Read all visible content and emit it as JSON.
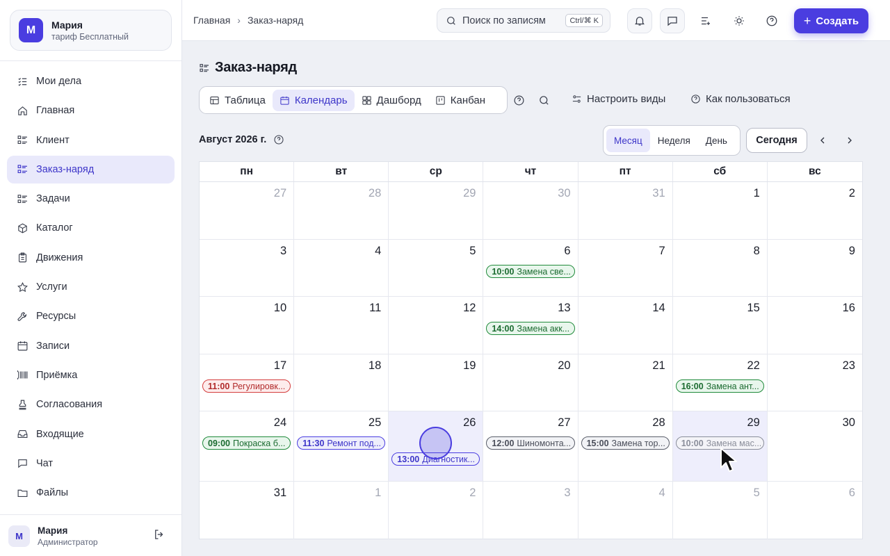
{
  "workspace": {
    "avatar": "М",
    "name": "Мария",
    "plan": "тариф Бесплатный"
  },
  "sidebar": {
    "items": [
      {
        "label": "Мои дела",
        "icon": "checklist-icon"
      },
      {
        "label": "Главная",
        "icon": "home-icon"
      },
      {
        "label": "Клиент",
        "icon": "list-icon"
      },
      {
        "label": "Заказ-наряд",
        "icon": "list-icon",
        "active": true
      },
      {
        "label": "Задачи",
        "icon": "list-icon"
      },
      {
        "label": "Каталог",
        "icon": "box-icon"
      },
      {
        "label": "Движения",
        "icon": "clipboard-icon"
      },
      {
        "label": "Услуги",
        "icon": "star-icon"
      },
      {
        "label": "Ресурсы",
        "icon": "wrench-icon"
      },
      {
        "label": "Записи",
        "icon": "calendar-icon"
      },
      {
        "label": "Приёмка",
        "icon": "barcode-icon"
      },
      {
        "label": "Согласования",
        "icon": "stamp-icon"
      },
      {
        "label": "Входящие",
        "icon": "inbox-icon"
      },
      {
        "label": "Чат",
        "icon": "chat-icon"
      },
      {
        "label": "Файлы",
        "icon": "folder-icon"
      }
    ]
  },
  "user": {
    "avatar": "М",
    "name": "Мария",
    "role": "Администратор"
  },
  "topbar": {
    "breadcrumb": [
      "Главная",
      "Заказ-наряд"
    ],
    "search_placeholder": "Поиск по записям",
    "search_shortcut": "Ctrl/⌘ K",
    "create_label": "Создать"
  },
  "page": {
    "title": "Заказ-наряд",
    "views": [
      {
        "label": "Таблица",
        "icon": "table-icon"
      },
      {
        "label": "Календарь",
        "icon": "calendar-icon",
        "active": true
      },
      {
        "label": "Дашборд",
        "icon": "dashboard-icon"
      },
      {
        "label": "Канбан",
        "icon": "kanban-icon"
      }
    ],
    "configure_views": "Настроить виды",
    "how_to_use": "Как пользоваться"
  },
  "calendar": {
    "month_label": "Август 2026 г.",
    "modes": [
      "Месяц",
      "Неделя",
      "День"
    ],
    "active_mode": "Месяц",
    "today_label": "Сегодня",
    "weekdays": [
      "пн",
      "вт",
      "ср",
      "чт",
      "пт",
      "сб",
      "вс"
    ],
    "days": [
      {
        "n": "27",
        "muted": true
      },
      {
        "n": "28",
        "muted": true
      },
      {
        "n": "29",
        "muted": true
      },
      {
        "n": "30",
        "muted": true
      },
      {
        "n": "31",
        "muted": true
      },
      {
        "n": "1"
      },
      {
        "n": "2"
      },
      {
        "n": "3"
      },
      {
        "n": "4"
      },
      {
        "n": "5"
      },
      {
        "n": "6",
        "events": [
          {
            "time": "10:00",
            "title": "Замена све...",
            "color": "green"
          }
        ]
      },
      {
        "n": "7"
      },
      {
        "n": "8"
      },
      {
        "n": "9"
      },
      {
        "n": "10"
      },
      {
        "n": "11"
      },
      {
        "n": "12"
      },
      {
        "n": "13",
        "events": [
          {
            "time": "14:00",
            "title": "Замена акк...",
            "color": "green"
          }
        ]
      },
      {
        "n": "14"
      },
      {
        "n": "15"
      },
      {
        "n": "16"
      },
      {
        "n": "17",
        "events": [
          {
            "time": "11:00",
            "title": "Регулировк...",
            "color": "red"
          }
        ]
      },
      {
        "n": "18"
      },
      {
        "n": "19"
      },
      {
        "n": "20"
      },
      {
        "n": "21"
      },
      {
        "n": "22",
        "events": [
          {
            "time": "16:00",
            "title": "Замена ант...",
            "color": "green"
          }
        ]
      },
      {
        "n": "23"
      },
      {
        "n": "24",
        "events": [
          {
            "time": "09:00",
            "title": "Покраска б...",
            "color": "green"
          }
        ]
      },
      {
        "n": "25",
        "events": [
          {
            "time": "11:30",
            "title": "Ремонт под...",
            "color": "purple"
          }
        ]
      },
      {
        "n": "26",
        "highlight": true,
        "events": [
          {
            "time": "13:00",
            "title": "Диагностик...",
            "color": "purple",
            "offset": 1
          }
        ]
      },
      {
        "n": "27",
        "events": [
          {
            "time": "12:00",
            "title": "Шиномонта...",
            "color": "gray"
          }
        ]
      },
      {
        "n": "28",
        "events": [
          {
            "time": "15:00",
            "title": "Замена тор...",
            "color": "gray"
          }
        ]
      },
      {
        "n": "29",
        "highlight": true,
        "events": [
          {
            "time": "10:00",
            "title": "Замена мас...",
            "color": "faded"
          }
        ]
      },
      {
        "n": "30"
      },
      {
        "n": "31"
      },
      {
        "n": "1",
        "muted": true
      },
      {
        "n": "2",
        "muted": true
      },
      {
        "n": "3",
        "muted": true
      },
      {
        "n": "4",
        "muted": true
      },
      {
        "n": "5",
        "muted": true
      },
      {
        "n": "6",
        "muted": true
      }
    ]
  }
}
